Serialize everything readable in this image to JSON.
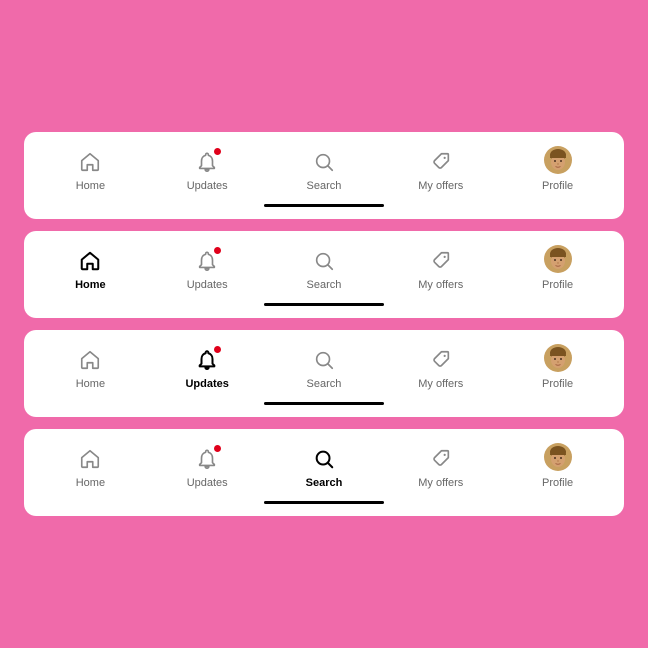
{
  "navbars": [
    {
      "id": "default",
      "active": "none",
      "items": [
        {
          "id": "home",
          "label": "Home"
        },
        {
          "id": "updates",
          "label": "Updates",
          "badge": true
        },
        {
          "id": "search",
          "label": "Search"
        },
        {
          "id": "myoffers",
          "label": "My offers"
        },
        {
          "id": "profile",
          "label": "Profile"
        }
      ]
    },
    {
      "id": "home-active",
      "active": "home",
      "items": [
        {
          "id": "home",
          "label": "Home"
        },
        {
          "id": "updates",
          "label": "Updates",
          "badge": true
        },
        {
          "id": "search",
          "label": "Search"
        },
        {
          "id": "myoffers",
          "label": "My offers"
        },
        {
          "id": "profile",
          "label": "Profile"
        }
      ]
    },
    {
      "id": "updates-active",
      "active": "updates",
      "items": [
        {
          "id": "home",
          "label": "Home"
        },
        {
          "id": "updates",
          "label": "Updates",
          "badge": true
        },
        {
          "id": "search",
          "label": "Search"
        },
        {
          "id": "myoffers",
          "label": "My offers"
        },
        {
          "id": "profile",
          "label": "Profile"
        }
      ]
    },
    {
      "id": "search-active",
      "active": "search",
      "items": [
        {
          "id": "home",
          "label": "Home"
        },
        {
          "id": "updates",
          "label": "Updates",
          "badge": true
        },
        {
          "id": "search",
          "label": "Search"
        },
        {
          "id": "myoffers",
          "label": "My offers"
        },
        {
          "id": "profile",
          "label": "Profile"
        }
      ]
    }
  ]
}
